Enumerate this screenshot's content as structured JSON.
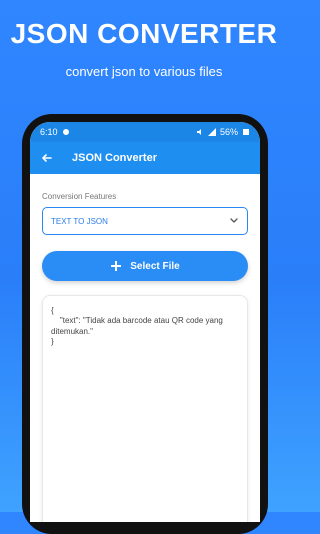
{
  "promo": {
    "title": "JSON CONVERTER",
    "subtitle": "convert json to various files"
  },
  "statusbar": {
    "time": "6:10",
    "battery": "56%"
  },
  "appbar": {
    "title": "JSON Converter"
  },
  "main": {
    "conversion_label": "Conversion Features",
    "selected_feature": "TEXT TO JSON",
    "select_button_label": "Select File",
    "output_text": "{\n    \"text\": \"Tidak ada barcode atau QR code yang ditemukan.\"\n}"
  },
  "colors": {
    "accent": "#1e8ef0",
    "button": "#2a8cf5"
  },
  "icons": {
    "back": "back-arrow-icon",
    "dropdown": "chevron-down-icon",
    "plus": "plus-icon"
  }
}
